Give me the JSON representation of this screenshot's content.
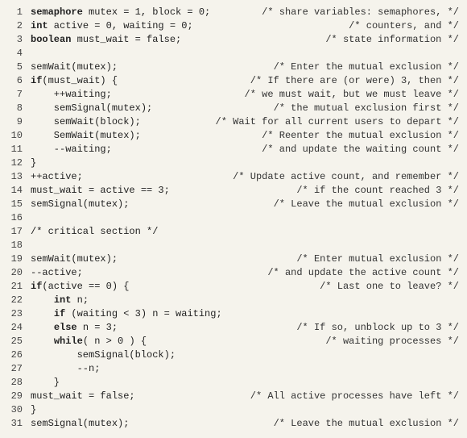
{
  "lines": [
    {
      "n": "1",
      "kw": "semaphore",
      "code": " mutex = 1, block = 0;",
      "comment": "/* share variables: semaphores, */"
    },
    {
      "n": "2",
      "kw": "int",
      "code": " active = 0, waiting = 0;",
      "comment": "/* counters, and */"
    },
    {
      "n": "3",
      "kw": "boolean",
      "code": " must_wait = false;",
      "comment": "/* state information */"
    },
    {
      "n": "4",
      "kw": "",
      "code": "",
      "comment": ""
    },
    {
      "n": "5",
      "kw": "",
      "code": "semWait(mutex);",
      "comment": "/* Enter the mutual exclusion */"
    },
    {
      "n": "6",
      "kw": "if",
      "code": "(must_wait) {",
      "comment": "/* If there are (or were) 3, then */"
    },
    {
      "n": "7",
      "kw": "",
      "code": "    ++waiting;",
      "comment": "/* we must wait, but we must leave */"
    },
    {
      "n": "8",
      "kw": "",
      "code": "    semSignal(mutex);",
      "comment": "/* the mutual exclusion first */"
    },
    {
      "n": "9",
      "kw": "",
      "code": "    semWait(block);",
      "comment": "/* Wait for all current users to depart */"
    },
    {
      "n": "10",
      "kw": "",
      "code": "    SemWait(mutex);",
      "comment": "/* Reenter the mutual exclusion */"
    },
    {
      "n": "11",
      "kw": "",
      "code": "    --waiting;",
      "comment": "/* and update the waiting count */"
    },
    {
      "n": "12",
      "kw": "",
      "code": "}",
      "comment": ""
    },
    {
      "n": "13",
      "kw": "",
      "code": "++active;",
      "comment": "/* Update active count, and remember */"
    },
    {
      "n": "14",
      "kw": "",
      "code": "must_wait = active == 3;",
      "comment": "/* if the count reached 3 */"
    },
    {
      "n": "15",
      "kw": "",
      "code": "semSignal(mutex);",
      "comment": "/* Leave the mutual exclusion */"
    },
    {
      "n": "16",
      "kw": "",
      "code": "",
      "comment": ""
    },
    {
      "n": "17",
      "kw": "",
      "code": "/* critical section */",
      "comment": ""
    },
    {
      "n": "18",
      "kw": "",
      "code": "",
      "comment": ""
    },
    {
      "n": "19",
      "kw": "",
      "code": "semWait(mutex);",
      "comment": "/* Enter mutual exclusion */"
    },
    {
      "n": "20",
      "kw": "",
      "code": "--active;",
      "comment": "/* and update the active count */"
    },
    {
      "n": "21",
      "kw": "if",
      "code": "(active == 0) {",
      "comment": "/* Last one to leave? */"
    },
    {
      "n": "22",
      "kw2": "int",
      "pre": "    ",
      "code": " n;",
      "comment": ""
    },
    {
      "n": "23",
      "kw2": "if",
      "pre": "    ",
      "code": " (waiting < 3) n = waiting;",
      "comment": ""
    },
    {
      "n": "24",
      "kw2": "else",
      "pre": "    ",
      "code": " n = 3;",
      "comment": "/* If so, unblock up to 3 */"
    },
    {
      "n": "25",
      "kw2": "while",
      "pre": "    ",
      "code": "( n > 0 ) {",
      "comment": "/* waiting processes */"
    },
    {
      "n": "26",
      "kw": "",
      "code": "        semSignal(block);",
      "comment": ""
    },
    {
      "n": "27",
      "kw": "",
      "code": "        --n;",
      "comment": ""
    },
    {
      "n": "28",
      "kw": "",
      "code": "    }",
      "comment": ""
    },
    {
      "n": "29",
      "kw": "",
      "code": "must_wait = false;",
      "comment": "/* All active processes have left */"
    },
    {
      "n": "30",
      "kw": "",
      "code": "}",
      "comment": ""
    },
    {
      "n": "31",
      "kw": "",
      "code": "semSignal(mutex);",
      "comment": "/* Leave the mutual exclusion */"
    }
  ]
}
